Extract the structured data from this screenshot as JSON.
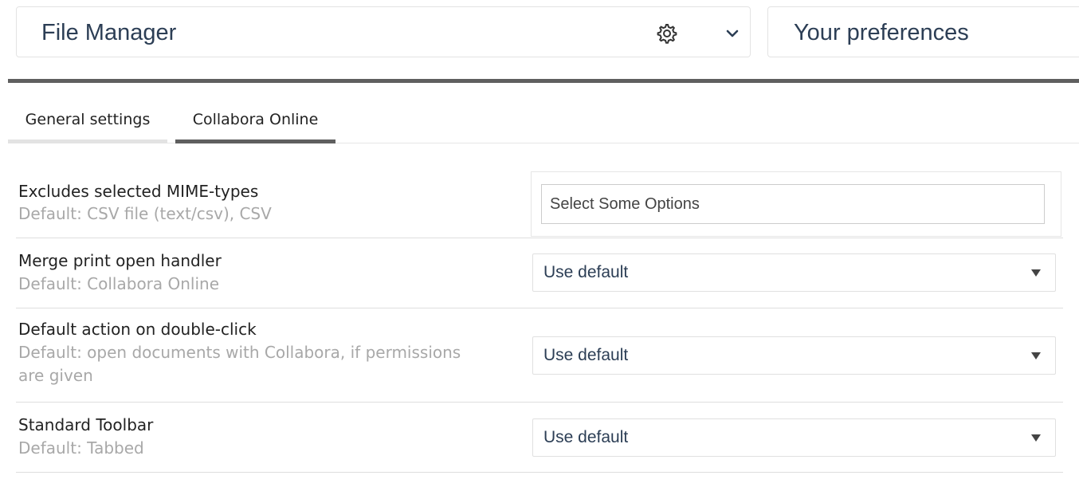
{
  "header": {
    "app_title": "File Manager",
    "settings_icon": "gear-icon",
    "dropdown_icon": "chevron-down-icon",
    "preferences_title": "Your preferences"
  },
  "tabs": [
    {
      "label": "General settings",
      "active": false
    },
    {
      "label": "Collabora Online",
      "active": true
    }
  ],
  "settings": {
    "mime_types": {
      "label": "Excludes selected MIME-types",
      "default": "Default: CSV file (text/csv), CSV",
      "placeholder": "Select Some Options"
    },
    "merge_print": {
      "label": "Merge print open handler",
      "default": "Default: Collabora Online",
      "value": "Use default"
    },
    "double_click": {
      "label": "Default action on double-click",
      "default": "Default: open documents with Collabora, if permissions are given",
      "value": "Use default"
    },
    "toolbar": {
      "label": "Standard Toolbar",
      "default": "Default: Tabbed",
      "value": "Use default"
    }
  },
  "colors": {
    "title_text": "#2c3e55",
    "active_tab_bar": "#5f5f5f",
    "inactive_tab_bar": "#e3e3e3",
    "default_text": "#a8a8a8"
  }
}
